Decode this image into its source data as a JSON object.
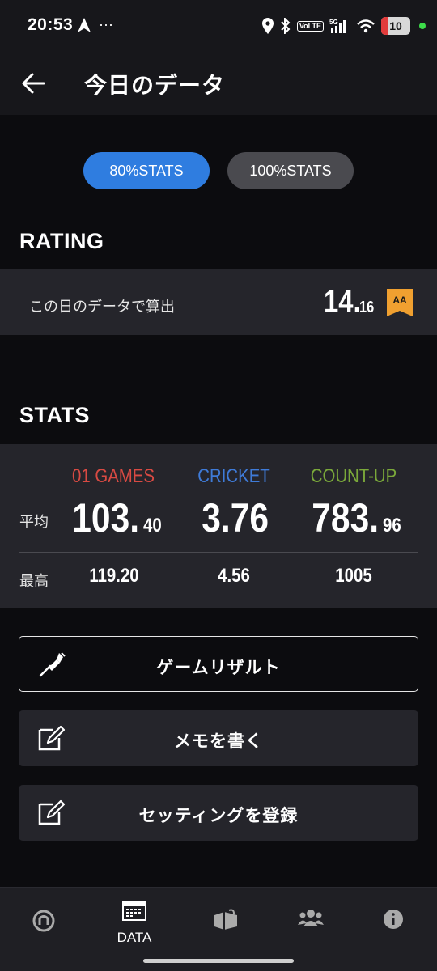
{
  "status_bar": {
    "time": "20:53",
    "more_indicator": "···",
    "battery_level": "10",
    "network": "5G",
    "volte": "VoLTE"
  },
  "header": {
    "title": "今日のデータ"
  },
  "toggle": {
    "active_label": "80%STATS",
    "inactive_label": "100%STATS"
  },
  "rating": {
    "section_title": "RATING",
    "row_label": "この日のデータで算出",
    "value_int": "14.",
    "value_dec": "16",
    "rank": "AA"
  },
  "stats": {
    "section_title": "STATS",
    "row_avg_label": "平均",
    "row_max_label": "最高",
    "columns": [
      {
        "name": "01 GAMES",
        "color": "#d94a43",
        "avg_int": "103.",
        "avg_dec": "40",
        "max": "119.20"
      },
      {
        "name": "CRICKET",
        "color": "#3f7bd8",
        "avg_int": "3.76",
        "avg_dec": "",
        "max": "4.56"
      },
      {
        "name": "COUNT-UP",
        "color": "#7aa83a",
        "avg_int": "783.",
        "avg_dec": "96",
        "max": "1005"
      }
    ]
  },
  "actions": {
    "game_result": "ゲームリザルト",
    "write_memo": "メモを書く",
    "register_setting": "セッティングを登録"
  },
  "bottom_nav": {
    "data_label": "DATA"
  },
  "colors": {
    "accent": "#2f7de0",
    "rank_badge": "#f0a030",
    "panel": "#25252b"
  }
}
